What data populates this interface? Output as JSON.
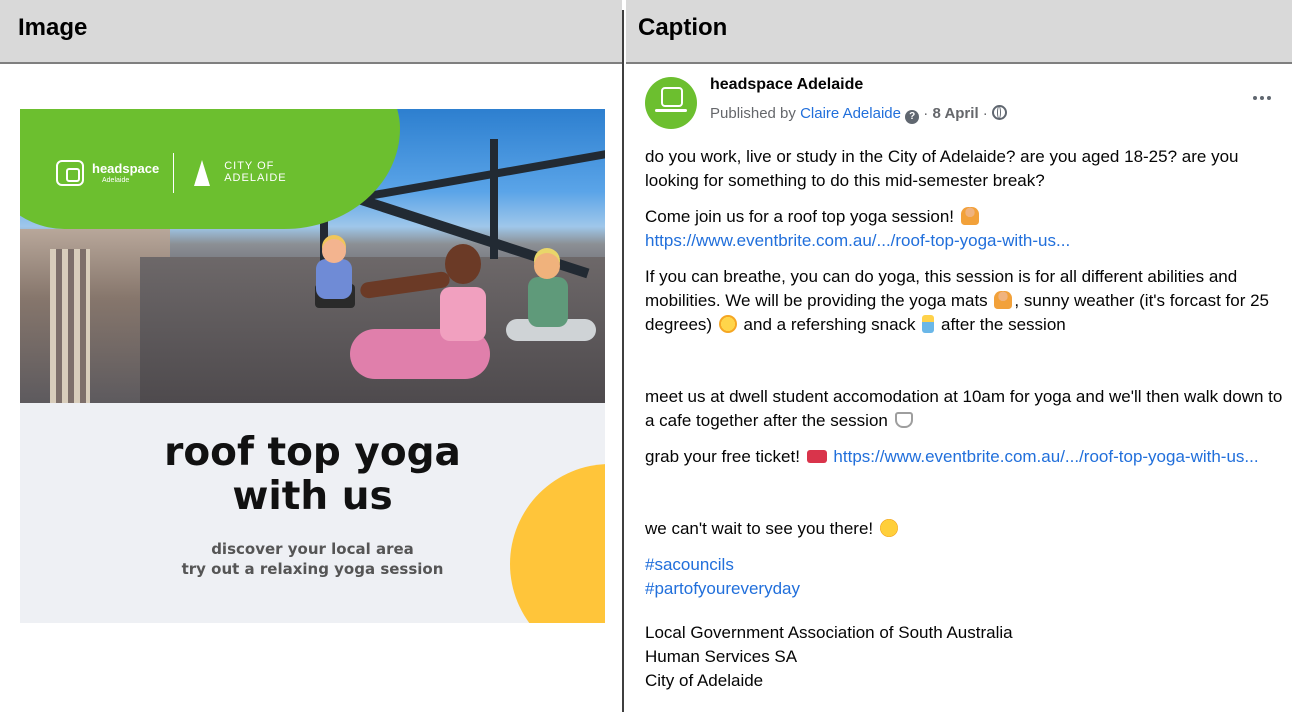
{
  "headers": {
    "image": "Image",
    "caption": "Caption"
  },
  "poster": {
    "logo_headspace": "headspace",
    "logo_headspace_sub": "Adelaide",
    "logo_city_line1": "CITY OF",
    "logo_city_line2": "ADELAIDE",
    "title_line1": "roof top yoga",
    "title_line2": "with us",
    "sub_line1": "discover your local area",
    "sub_line2": "try out a relaxing yoga session"
  },
  "post": {
    "page_name": "headspace Adelaide",
    "published_by": "Published by ",
    "author": "Claire Adelaide",
    "date": "8 April",
    "sep": " · ",
    "p1": "do you work, live or study in the City of Adelaide? are you aged 18-25? are you looking for something to do this mid-semester break?",
    "p2_text": "Come join us for a roof top yoga session! ",
    "p2_link": "https://www.eventbrite.com.au/.../roof-top-yoga-with-us...",
    "p3_a": "If you can breathe, you can do yoga, this session is for all different abilities and mobilities. We will be providing the yoga mats ",
    "p3_b": ", sunny weather (it's forcast for 25 degrees) ",
    "p3_c": " and a refershing snack ",
    "p3_d": " after the session",
    "p4": "meet us at dwell student accomodation at 10am for yoga and we'll then walk down to a cafe together after the session ",
    "p5_text": "grab your free ticket! ",
    "p5_link": "https://www.eventbrite.com.au/.../roof-top-yoga-with-us...",
    "p6": "we can't wait to see you there! ",
    "hashtag1": "#sacouncils",
    "hashtag2": "#partofyoureveryday",
    "tag1": "Local Government Association of South Australia",
    "tag2": "Human Services SA",
    "tag3": "City of Adelaide"
  },
  "colors": {
    "brand_green": "#6cbf2f",
    "link_blue": "#216fdb",
    "accent_yellow": "#ffc53a"
  }
}
